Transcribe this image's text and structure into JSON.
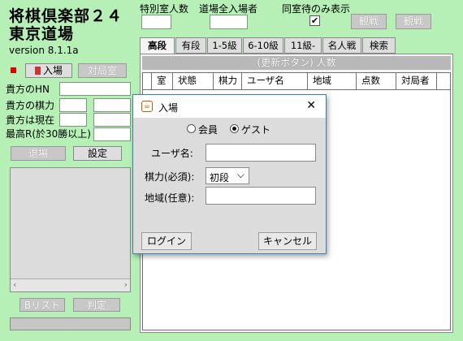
{
  "app": {
    "title_line1": "将棋倶楽部２４",
    "title_line2": "東京道場",
    "version": "version 8.1.1a"
  },
  "top": {
    "special_rooms_label": "特別室人数",
    "dojo_entrants_label": "道場全入場者",
    "same_room_only_label": "同室待のみ表示",
    "same_room_only_checked": true,
    "watch_button": "観戦",
    "spectate_button": "観戦"
  },
  "left": {
    "enter_button": "入場",
    "opponent_room_button": "対局室",
    "hn_label": "貴方のHN",
    "rating_label": "貴方の棋力",
    "current_label": "貴方は現在",
    "best_label": "最高R(於30勝以上)",
    "leave_button": "退場",
    "settings_button": "設定",
    "blist_button": "Bリスト",
    "judge_button": "判定"
  },
  "tabs": [
    "高段",
    "有段",
    "1-5級",
    "6-10級",
    "11級-",
    "名人戦",
    "検索"
  ],
  "active_tab": 0,
  "table": {
    "banner": "(更新ボタン) 人数",
    "columns": [
      "室",
      "状態",
      "棋力",
      "ユーザ名",
      "地域",
      "点数",
      "対局者"
    ]
  },
  "dialog": {
    "title": "入場",
    "close_glyph": "✕",
    "radio_member": "会員",
    "radio_guest": "ゲスト",
    "selected_radio": "guest",
    "username_label": "ユーザ名:",
    "username_value": "",
    "rating_label": "棋力(必須):",
    "rating_value": "初段",
    "region_label": "地域(任意):",
    "region_value": "",
    "login_button": "ログイン",
    "cancel_button": "キャンセル"
  },
  "colors": {
    "background": "#b6f0b6",
    "red_indicator": "#e00000",
    "dialog_border": "#3c7fb1"
  }
}
